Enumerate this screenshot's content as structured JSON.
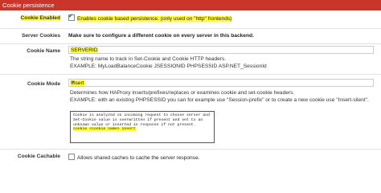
{
  "section_title": "Cookie persistence",
  "cookie_enabled": {
    "label": "Cookie Enabled",
    "checked": true,
    "text": "Enables cookie based persistence. (only used on \"http\" frontends)"
  },
  "server_cookies": {
    "label": "Server Cookies",
    "text": "Make sure to configure a different cookie on every server in this backend."
  },
  "cookie_name": {
    "label": "Cookie Name",
    "value": "SERVERID",
    "help_1": "The string name to track in Set-Cookie and Cookie HTTP headers.",
    "help_2": "EXAMPLE: MyLoadBalanceCookie JSESSIONID PHPSESSID ASP.NET_SessionId"
  },
  "cookie_mode": {
    "label": "Cookie Mode",
    "selected": "Insert",
    "help_1": "Determines how HAProxy inserts/prefixes/replaces or examines cookie and set-cookie headers.",
    "help_2": "EXAMPLE: with an existing PHPSESSID you can for example use \"Session-prefix\" or to create a new cookie use \"Insert-silent\".",
    "info_lines": [
      "Cookie is analyzed on incoming request to choose server and",
      "Set-Cookie value is overwritten if present and set to an",
      "unknown value or inserted in response if not present.",
      "",
      "cookie <cookie name> insert"
    ]
  },
  "cookie_cachable": {
    "label": "Cookie Cachable",
    "checked": false,
    "text": "Allows shared caches to cache the server response."
  }
}
